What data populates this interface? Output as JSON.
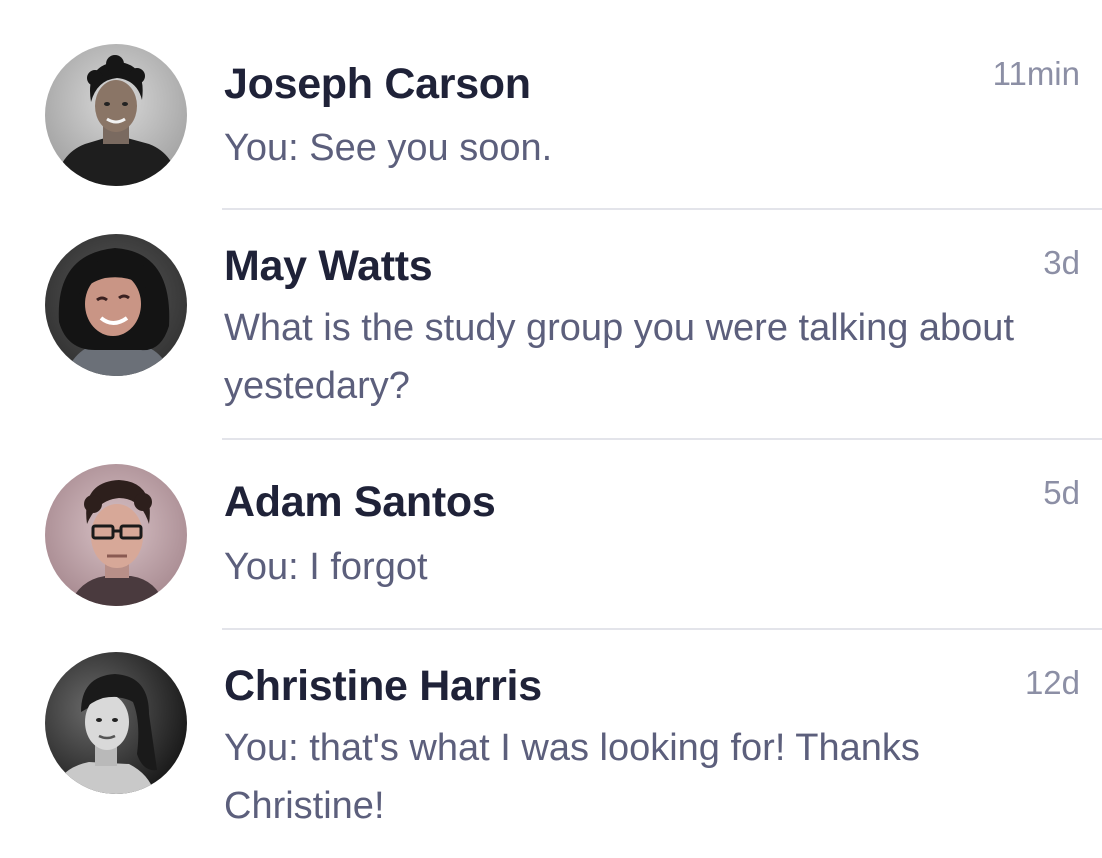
{
  "conversations": [
    {
      "name": "Joseph Carson",
      "time": "11min",
      "message": "You: See you soon.",
      "avatar_icon": "avatar-photo"
    },
    {
      "name": "May Watts",
      "time": "3d",
      "message": "What is the study group you were talking about yestedary?",
      "avatar_icon": "avatar-photo"
    },
    {
      "name": "Adam Santos",
      "time": "5d",
      "message": "You: I forgot",
      "avatar_icon": "avatar-photo"
    },
    {
      "name": "Christine Harris",
      "time": "12d",
      "message": "You: that's what I was looking for! Thanks Christine!",
      "avatar_icon": "avatar-photo"
    }
  ],
  "colors": {
    "name_text": "#1f2238",
    "message_text": "#5c5f7c",
    "time_text": "#8c8fa5",
    "divider": "#e3e4ea"
  }
}
